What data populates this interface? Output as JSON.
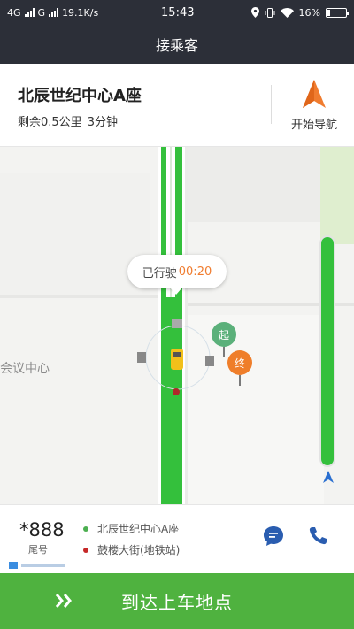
{
  "status_bar": {
    "network_1": "4G",
    "network_2": "G",
    "speed": "19.1K/s",
    "time": "15:43",
    "battery": "16%",
    "battery_level": 0.16
  },
  "header": {
    "title": "接乘客"
  },
  "destination": {
    "name": "北辰世纪中心A座",
    "distance": "剩余0.5公里",
    "time": "3分钟",
    "nav_label": "开始导航"
  },
  "map": {
    "area_label": "会议中心",
    "trip_label": "已行驶",
    "trip_time": "00:20",
    "start_marker": "起",
    "end_marker": "终",
    "colors": {
      "road": "#34c03c",
      "start": "#5bb07a",
      "end": "#ef7e2a"
    }
  },
  "info": {
    "plate": "*888",
    "plate_label": "尾号",
    "pickup": "北辰世纪中心A座",
    "dropoff": "鼓楼大街(地铁站)",
    "colors": {
      "pickup_dot": "#4caf50",
      "dropoff_dot": "#c62828",
      "icon": "#2a5db0"
    }
  },
  "action": {
    "label": "到达上车地点",
    "color": "#4fb23f"
  }
}
